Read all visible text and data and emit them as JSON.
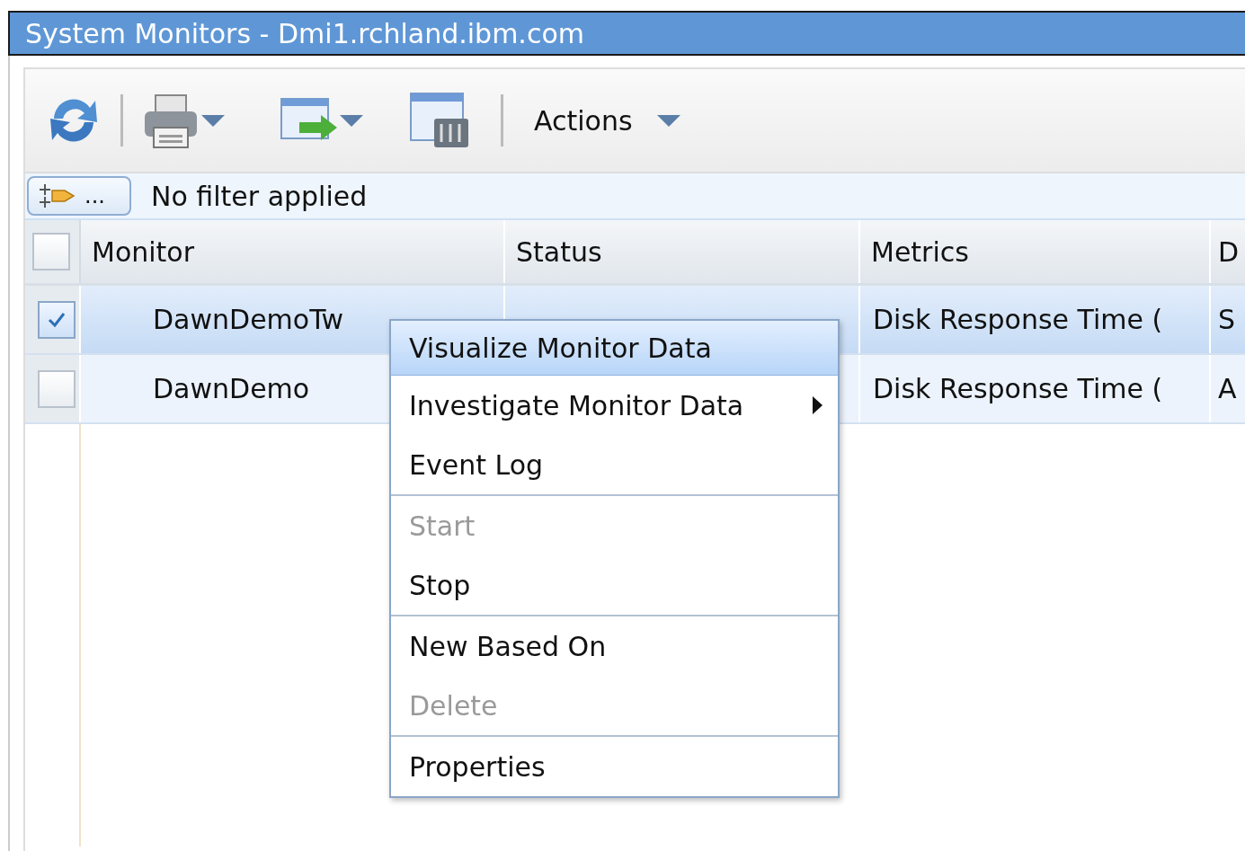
{
  "window": {
    "title": "System Monitors - Dmi1.rchland.ibm.com"
  },
  "toolbar": {
    "menu_label": "Actions"
  },
  "filter": {
    "button_label": "...",
    "text": "No filter applied"
  },
  "table": {
    "header_checked": false,
    "columns": [
      "Monitor",
      "Status",
      "Metrics",
      "D"
    ],
    "rows": [
      {
        "selected": true,
        "cells": [
          "DawnDemoTw",
          "",
          "Disk Response Time (",
          "S"
        ]
      },
      {
        "selected": false,
        "cells": [
          "DawnDemo",
          "",
          "Disk Response Time (",
          "A"
        ]
      }
    ]
  },
  "context_menu": {
    "groups": [
      [
        {
          "label": "Visualize Monitor Data",
          "selected": true,
          "disabled": false,
          "submenu": false
        },
        {
          "label": "Investigate Monitor Data",
          "selected": false,
          "disabled": false,
          "submenu": true
        },
        {
          "label": "Event Log",
          "selected": false,
          "disabled": false,
          "submenu": false
        }
      ],
      [
        {
          "label": "Start",
          "selected": false,
          "disabled": true,
          "submenu": false
        },
        {
          "label": "Stop",
          "selected": false,
          "disabled": false,
          "submenu": false
        }
      ],
      [
        {
          "label": "New Based On",
          "selected": false,
          "disabled": false,
          "submenu": false
        },
        {
          "label": "Delete",
          "selected": false,
          "disabled": true,
          "submenu": false
        }
      ],
      [
        {
          "label": "Properties",
          "selected": false,
          "disabled": false,
          "submenu": false
        }
      ]
    ]
  }
}
